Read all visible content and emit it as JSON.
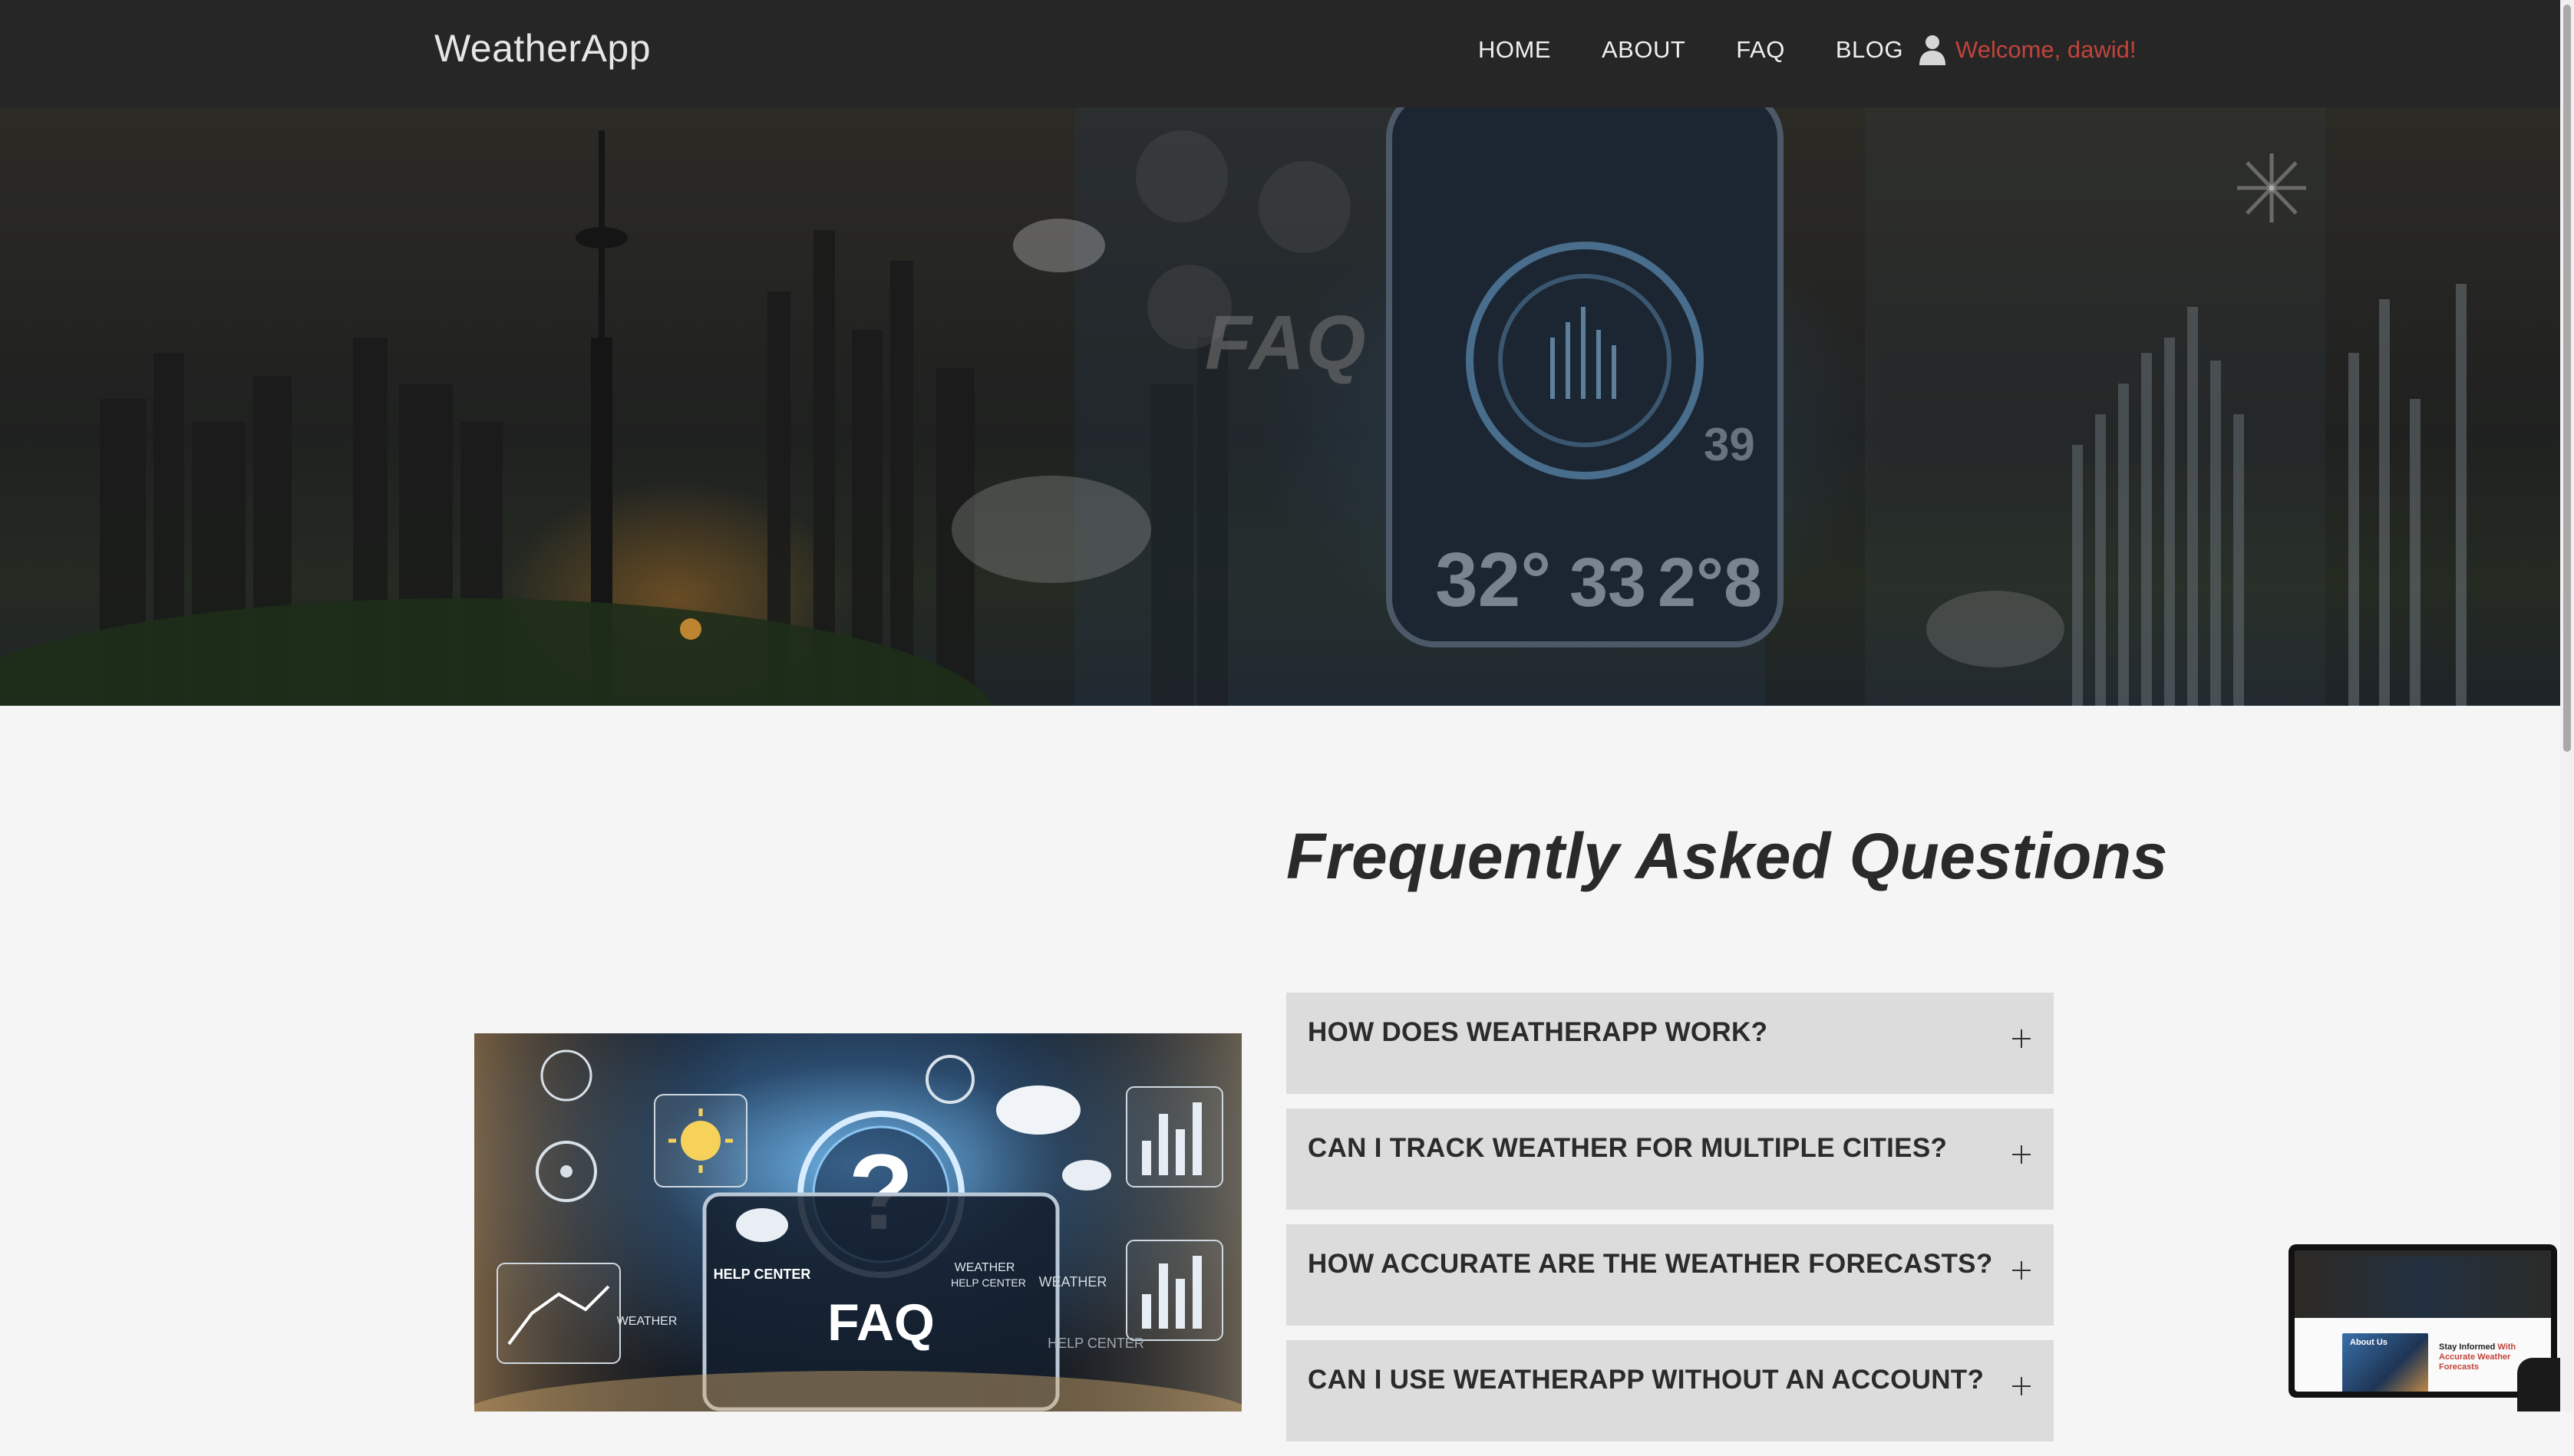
{
  "navbar": {
    "brand": "WeatherApp",
    "links": [
      "HOME",
      "ABOUT",
      "FAQ",
      "BLOG"
    ],
    "welcome": "Welcome, dawid!",
    "welcome_color": "#c1443b"
  },
  "hero": {
    "overlay_text": "FAQ",
    "readouts": [
      "32°",
      "33",
      "2°8",
      "39"
    ]
  },
  "faq": {
    "title": "Frequently Asked Questions",
    "items": [
      "HOW DOES WEATHERAPP WORK?",
      "CAN I TRACK WEATHER FOR MULTIPLE CITIES?",
      "HOW ACCURATE ARE THE WEATHER FORECASTS?",
      "CAN I USE WEATHERAPP WITHOUT AN ACCOUNT?"
    ],
    "item_icon": "plus-icon"
  },
  "faq_image": {
    "center_text": "FAQ",
    "labels": [
      "HELP CENTER",
      "WEATHER",
      "WEATHER",
      "HELP CENTER",
      "WEATHER",
      "HELP CENTER"
    ]
  },
  "preview": {
    "line1": "Stay Informed",
    "line1_red": "With",
    "line2": "Accurate Weather",
    "line3": "Forecasts",
    "tag": "About Us"
  }
}
